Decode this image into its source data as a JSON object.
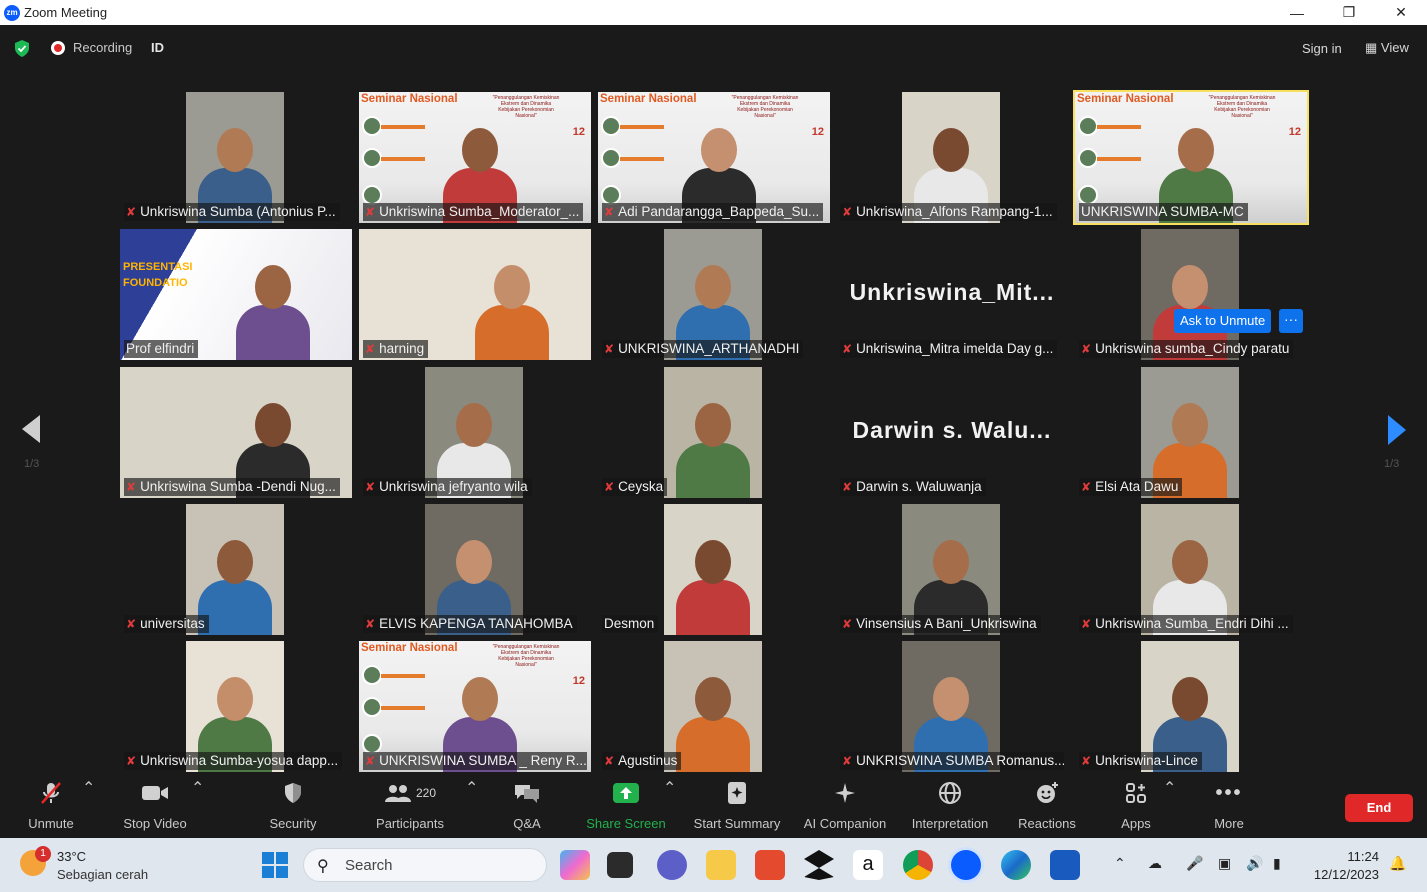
{
  "window": {
    "title": "Zoom Meeting",
    "logo": "zm"
  },
  "topbar": {
    "recording_label": "Recording",
    "id_label": "ID",
    "sign_in": "Sign in",
    "view": "View"
  },
  "pagination": {
    "left": "1/3",
    "right": "1/3"
  },
  "popups": {
    "ask_unmute": "Ask to Unmute",
    "more": "···"
  },
  "tiles": [
    {
      "name": "Unkriswina Sumba (Antonius P...",
      "muted": true,
      "kind": "video"
    },
    {
      "name": "Unkriswina Sumba_Moderator_...",
      "muted": true,
      "kind": "seminar"
    },
    {
      "name": "Adi Pandarangga_Bappeda_Su...",
      "muted": true,
      "kind": "seminar"
    },
    {
      "name": "Unkriswina_Alfons Rampang-1...",
      "muted": true,
      "kind": "video"
    },
    {
      "name": "UNKRISWINA SUMBA-MC",
      "muted": false,
      "kind": "seminar",
      "active": true
    },
    {
      "name": "Prof elfindri",
      "muted": false,
      "kind": "presentation",
      "overlay": "PRESENTASI FOUNDATIO"
    },
    {
      "name": "harning",
      "muted": true,
      "kind": "video"
    },
    {
      "name": "UNKRISWINA_ARTHANADHI",
      "muted": true,
      "kind": "video"
    },
    {
      "name": "Unkriswina_Mitra imelda Day g...",
      "muted": true,
      "kind": "name",
      "big": "Unkriswina_Mit..."
    },
    {
      "name": "Unkriswina sumba_Cindy paratu",
      "muted": true,
      "kind": "video"
    },
    {
      "name": "Unkriswina Sumba -Dendi Nug...",
      "muted": true,
      "kind": "video"
    },
    {
      "name": "Unkriswina jefryanto wila",
      "muted": true,
      "kind": "video"
    },
    {
      "name": "Ceyska",
      "muted": true,
      "kind": "video"
    },
    {
      "name": "Darwin s. Waluwanja",
      "muted": true,
      "kind": "name",
      "big": "Darwin s. Walu..."
    },
    {
      "name": "Elsi Ata Dawu",
      "muted": true,
      "kind": "video"
    },
    {
      "name": "universitas",
      "muted": true,
      "kind": "video"
    },
    {
      "name": "ELVIS KAPENGA TANAHOMBA",
      "muted": true,
      "kind": "video"
    },
    {
      "name": "Desmon",
      "muted": false,
      "kind": "video"
    },
    {
      "name": "Vinsensius A Bani_Unkriswina",
      "muted": true,
      "kind": "video"
    },
    {
      "name": "Unkriswina Sumba_Endri Dihi ...",
      "muted": true,
      "kind": "video"
    },
    {
      "name": "Unkriswina Sumba-yosua dapp...",
      "muted": true,
      "kind": "video"
    },
    {
      "name": "UNKRISWINA SUMBA _ Reny R...",
      "muted": true,
      "kind": "seminar"
    },
    {
      "name": "Agustinus",
      "muted": true,
      "kind": "video"
    },
    {
      "name": "UNKRISWINA SUMBA Romanus...",
      "muted": true,
      "kind": "video"
    },
    {
      "name": "Unkriswina-Lince",
      "muted": true,
      "kind": "video"
    }
  ],
  "seminar": {
    "title": "Seminar Nasional",
    "tag": "\"Penanggulangan Kemiskinan Ekstrem dan Dinamika Kebijakan Perekonomian Nasional\"",
    "date": "12"
  },
  "toolbar": {
    "unmute": "Unmute",
    "stop_video": "Stop Video",
    "security": "Security",
    "participants": "Participants",
    "participants_count": "220",
    "qa": "Q&A",
    "share_screen": "Share Screen",
    "start_summary": "Start Summary",
    "ai_companion": "AI Companion",
    "interpretation": "Interpretation",
    "reactions": "Reactions",
    "apps": "Apps",
    "more": "More",
    "end": "End",
    "share_color": "#22b14c"
  },
  "taskbar": {
    "weather_badge": "1",
    "temperature": "33°C",
    "condition": "Sebagian cerah",
    "search": "Search",
    "time": "11:24",
    "date": "12/12/2023"
  }
}
